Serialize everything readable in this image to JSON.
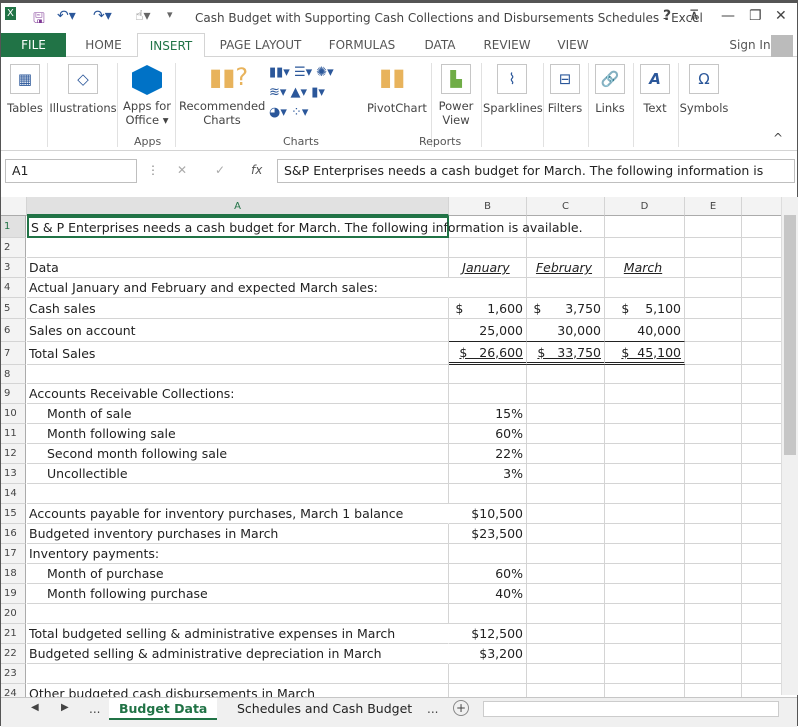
{
  "title": "Cash Budget with Supporting Cash Collections and Disbursements Schedules - Excel",
  "window": {
    "help": "?",
    "restore_ribbon": "⊼",
    "minimize": "—",
    "restore": "❐",
    "close": "✕"
  },
  "tabs": [
    "FILE",
    "HOME",
    "INSERT",
    "PAGE LAYOUT",
    "FORMULAS",
    "DATA",
    "REVIEW",
    "VIEW"
  ],
  "sign_in": "Sign In",
  "ribbon": {
    "tables": "Tables",
    "illustrations": "Illustrations",
    "apps_for": "Apps for",
    "office": "Office ▾",
    "recommended": "Recommended",
    "charts_l": "Charts",
    "pivotchart": "PivotChart",
    "power": "Power",
    "view": "View",
    "sparklines": "Sparklines",
    "filters": "Filters",
    "links": "Links",
    "text": "Text",
    "symbols": "Symbols",
    "groups": {
      "apps": "Apps",
      "charts": "Charts",
      "reports": "Reports"
    }
  },
  "formula_bar": {
    "name_box": "A1",
    "fx": "fx",
    "content": "S&P Enterprises needs a cash budget for March. The following information is"
  },
  "columns": [
    "A",
    "B",
    "C",
    "D",
    "E"
  ],
  "rows": [
    {
      "n": "1",
      "a": "S & P Enterprises needs a cash budget for March. The following information is available."
    },
    {
      "n": "2"
    },
    {
      "n": "3",
      "a": "Data",
      "b": "January",
      "c": "February",
      "d": "March"
    },
    {
      "n": "4",
      "a": "Actual January and February and expected March sales:"
    },
    {
      "n": "5",
      "a": "Cash sales",
      "b": "$      1,600",
      "c": "$      3,750",
      "d": "$    5,100"
    },
    {
      "n": "6",
      "a": "Sales on account",
      "b": "25,000",
      "c": "30,000",
      "d": "40,000"
    },
    {
      "n": "7",
      "a": "Total Sales",
      "b": "$   26,600",
      "c": "$   33,750",
      "d": "$  45,100"
    },
    {
      "n": "8"
    },
    {
      "n": "9",
      "a": "Accounts Receivable Collections:"
    },
    {
      "n": "10",
      "a": "Month of sale",
      "ind": true,
      "b": "15%"
    },
    {
      "n": "11",
      "a": "Month following sale",
      "ind": true,
      "b": "60%"
    },
    {
      "n": "12",
      "a": "Second month following sale",
      "ind": true,
      "b": "22%"
    },
    {
      "n": "13",
      "a": "Uncollectible",
      "ind": true,
      "b": "3%"
    },
    {
      "n": "14"
    },
    {
      "n": "15",
      "a": "Accounts payable for inventory purchases, March 1 balance",
      "b": "$10,500"
    },
    {
      "n": "16",
      "a": "Budgeted inventory purchases in March",
      "b": "$23,500"
    },
    {
      "n": "17",
      "a": "Inventory payments:"
    },
    {
      "n": "18",
      "a": "Month of purchase",
      "ind": true,
      "b": "60%"
    },
    {
      "n": "19",
      "a": "Month following purchase",
      "ind": true,
      "b": "40%"
    },
    {
      "n": "20"
    },
    {
      "n": "21",
      "a": "Total budgeted selling & administrative expenses in March",
      "b": "$12,500"
    },
    {
      "n": "22",
      "a": "Budgeted selling & administrative depreciation in March",
      "b": "$3,200"
    },
    {
      "n": "23"
    },
    {
      "n": "24",
      "a": "Other budgeted cash disbursements in March"
    }
  ],
  "sheets": {
    "more_left": "...",
    "tab1": "Budget Data",
    "tab2": "Schedules and Cash Budget",
    "more_right": "...",
    "add": "+"
  }
}
